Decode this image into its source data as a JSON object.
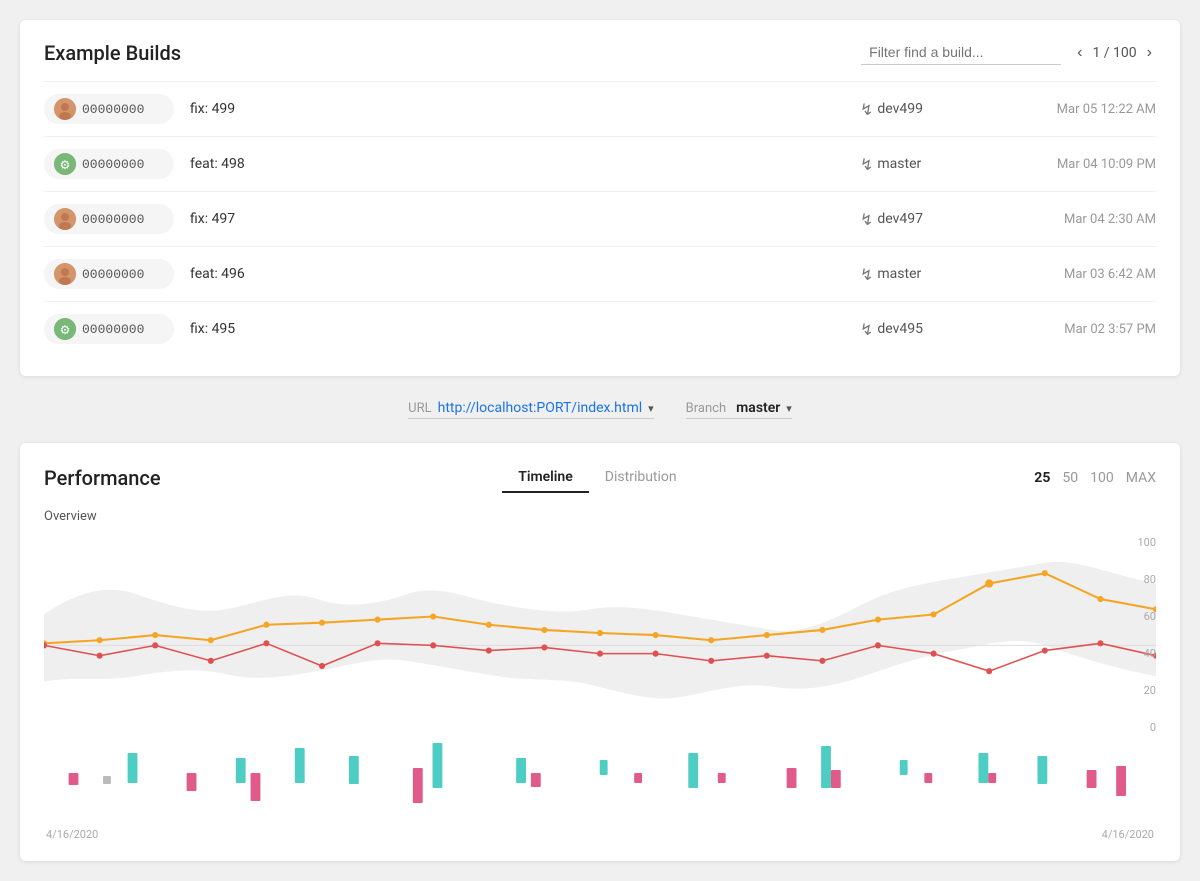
{
  "builds": {
    "title": "Example Builds",
    "filter_placeholder": "Filter find a build...",
    "pagination": {
      "current": 1,
      "total": 100,
      "label": "1 / 100"
    },
    "rows": [
      {
        "id": "00000000",
        "avatar_type": "human",
        "description": "fix: 499",
        "branch": "dev499",
        "date": "Mar 05 12:22 AM"
      },
      {
        "id": "00000000",
        "avatar_type": "gear",
        "description": "feat: 498",
        "branch": "master",
        "date": "Mar 04 10:09 PM"
      },
      {
        "id": "00000000",
        "avatar_type": "human",
        "description": "fix: 497",
        "branch": "dev497",
        "date": "Mar 04 2:30 AM"
      },
      {
        "id": "00000000",
        "avatar_type": "human",
        "description": "feat: 496",
        "branch": "master",
        "date": "Mar 03 6:42 AM"
      },
      {
        "id": "00000000",
        "avatar_type": "gear",
        "description": "fix: 495",
        "branch": "dev495",
        "date": "Mar 02 3:57 PM"
      }
    ]
  },
  "selectors": {
    "url_label": "URL",
    "url_value": "http://localhost:PORT/index.html",
    "branch_label": "Branch",
    "branch_value": "master"
  },
  "performance": {
    "title": "Performance",
    "tabs": [
      "Timeline",
      "Distribution"
    ],
    "active_tab": "Timeline",
    "count_options": [
      "25",
      "50",
      "100",
      "MAX"
    ],
    "active_count": "25",
    "chart_label": "Overview",
    "y_axis": [
      "100",
      "80",
      "60",
      "40",
      "20",
      "0"
    ],
    "date_start": "4/16/2020",
    "date_end": "4/16/2020"
  }
}
